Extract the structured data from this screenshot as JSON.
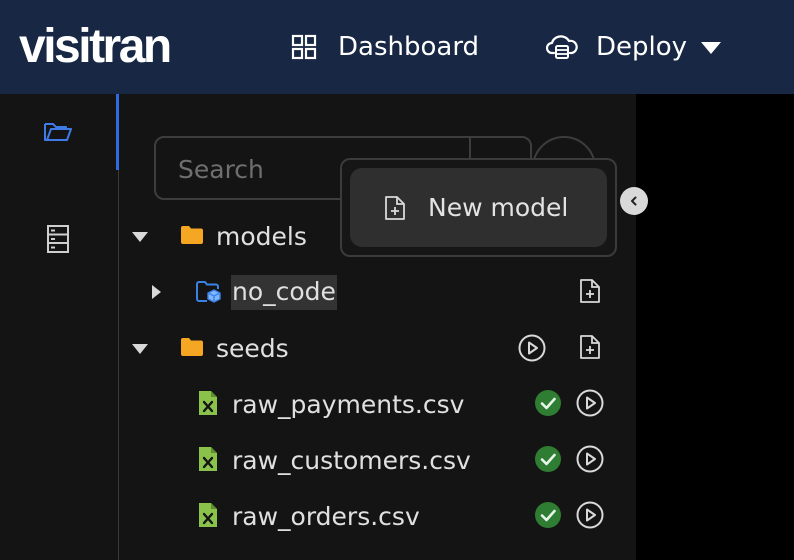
{
  "header": {
    "logo_text": "visitran",
    "nav": {
      "dashboard_label": "Dashboard",
      "deploy_label": "Deploy"
    }
  },
  "rail": {
    "items": [
      {
        "icon": "folder-open-icon",
        "active": true
      },
      {
        "icon": "database-icon",
        "active": false
      }
    ],
    "accent_color": "#2f6be0"
  },
  "explorer": {
    "search": {
      "placeholder": "Search",
      "value": ""
    },
    "tree": {
      "models": {
        "label": "models",
        "expanded": true
      },
      "no_code": {
        "label": "no_code",
        "expanded": false
      },
      "seeds": {
        "label": "seeds",
        "expanded": true
      },
      "files": [
        {
          "name": "raw_payments.csv",
          "status": "success"
        },
        {
          "name": "raw_customers.csv",
          "status": "success"
        },
        {
          "name": "raw_orders.csv",
          "status": "success"
        }
      ]
    },
    "folder_color": "#f5a623",
    "file_color": "#8bc34a",
    "success_color": "#2e7d32"
  },
  "popup": {
    "new_model_label": "New model"
  }
}
